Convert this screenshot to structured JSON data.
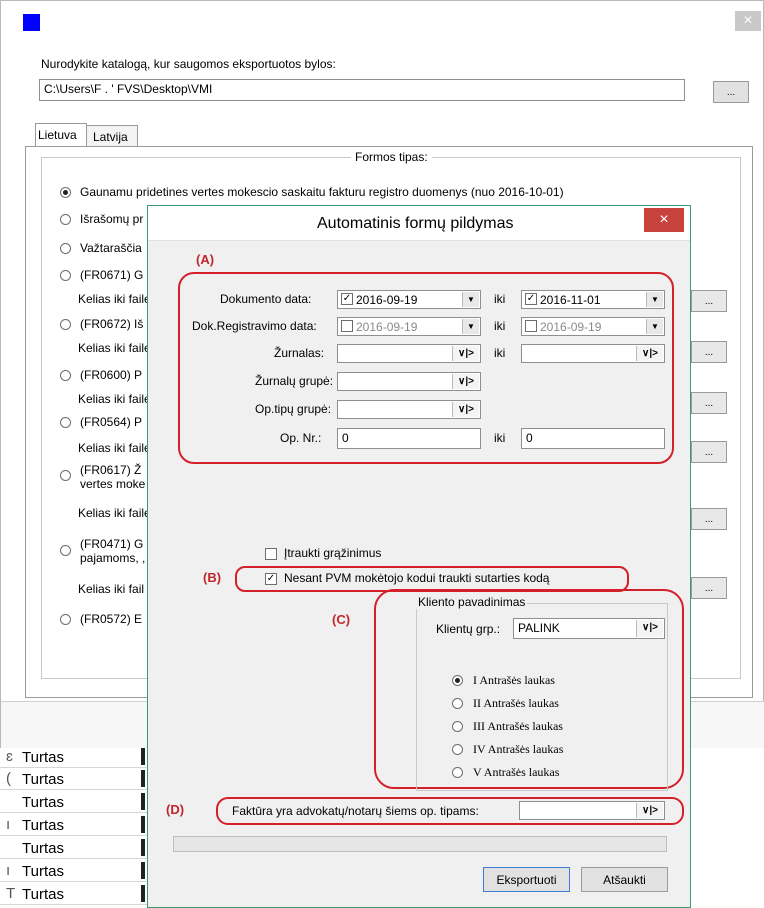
{
  "main_window": {
    "close_glyph": "×",
    "folder_prompt": "Nurodykite katalogą, kur saugomos eksportuotos bylos:",
    "folder_value": "C:\\Users\\F . ' FVS\\Desktop\\VMI",
    "browse_label": "...",
    "tabs": [
      {
        "label": "Lietuva"
      },
      {
        "label": "Latvija"
      }
    ],
    "group_title": "Formos tipas:",
    "options": [
      {
        "label": "Gaunamu pridetines vertes mokescio saskaitu fakturu registro duomenys (nuo 2016-10-01)",
        "selected": true
      },
      {
        "label": "Išrašomų pr",
        "selected": false
      },
      {
        "label": "Važtaraščia",
        "selected": false
      },
      {
        "label": "(FR0671) G",
        "selected": false
      },
      {
        "label": "(FR0672) Iš",
        "selected": false
      },
      {
        "label": "(FR0600) P",
        "selected": false
      },
      {
        "label": "(FR0564) P",
        "selected": false
      },
      {
        "label": "(FR0617) Ž",
        "selected": false
      },
      {
        "label": "(FR0471) G",
        "selected": false
      },
      {
        "label": "(FR0572) E",
        "selected": false
      }
    ],
    "option_sublines": {
      "fr0617": "vertes moke",
      "fr0471": "pajamoms, ,"
    },
    "path_label": "Kelias iki faile",
    "path_label_short": "Kelias iki fail"
  },
  "sheet": {
    "rows": [
      {
        "mark": "ɛ",
        "text": "Turtas"
      },
      {
        "mark": "(",
        "text": "Turtas"
      },
      {
        "mark": "",
        "text": "Turtas"
      },
      {
        "mark": "ı",
        "text": "Turtas"
      },
      {
        "mark": "",
        "text": "Turtas"
      },
      {
        "mark": "ı",
        "text": "Turtas"
      },
      {
        "mark": "T",
        "text": "Turtas"
      }
    ]
  },
  "dialog": {
    "title": "Automatinis formų pildymas",
    "close_glyph": "×",
    "annotation_a": "(A)",
    "annotation_b": "(B)",
    "annotation_c": "(C)",
    "annotation_d": "(D)",
    "doc_date_label": "Dokumento data:",
    "doc_date_from": "2016-09-19",
    "doc_date_to": "2016-11-01",
    "reg_date_label": "Dok.Registravimo data:",
    "reg_date_from": "2016-09-19",
    "reg_date_to": "2016-09-19",
    "iki": "iki",
    "zurnalas_label": "Žurnalas:",
    "zurnalu_grupe_label": "Žurnalų grupė:",
    "optipu_grupe_label": "Op.tipų grupė:",
    "opnr_label": "Op. Nr.:",
    "opnr_from": "0",
    "opnr_to": "0",
    "vbtn_glyph": "∨|>",
    "dropdown_glyph": "▼",
    "include_returns": {
      "label": "Įtraukti grąžinimus",
      "checked": false
    },
    "contract_code": {
      "label": "Nesant PVM mokėtojo kodui traukti sutarties kodą",
      "checked": true
    },
    "client_group": {
      "title": "Kliento pavadinimas",
      "grp_label": "Klientų grp.:",
      "grp_value": "PALINK",
      "options": [
        {
          "label": "I Antrašės laukas",
          "selected": true
        },
        {
          "label": "II Antrašės laukas",
          "selected": false
        },
        {
          "label": "III Antrašės laukas",
          "selected": false
        },
        {
          "label": "IV Antrašės laukas",
          "selected": false
        },
        {
          "label": "V Antrašės laukas",
          "selected": false
        }
      ]
    },
    "lawyer_label": "Faktūra yra advokatų/notarų šiems op. tipams:",
    "lawyer_value": "",
    "export_button": "Eksportuoti",
    "cancel_button": "Atšaukti"
  },
  "colors": {
    "dialog_border": "#3c9b6e",
    "annotation_red": "#d3202a",
    "titlebar_icon": "#0000ff"
  }
}
